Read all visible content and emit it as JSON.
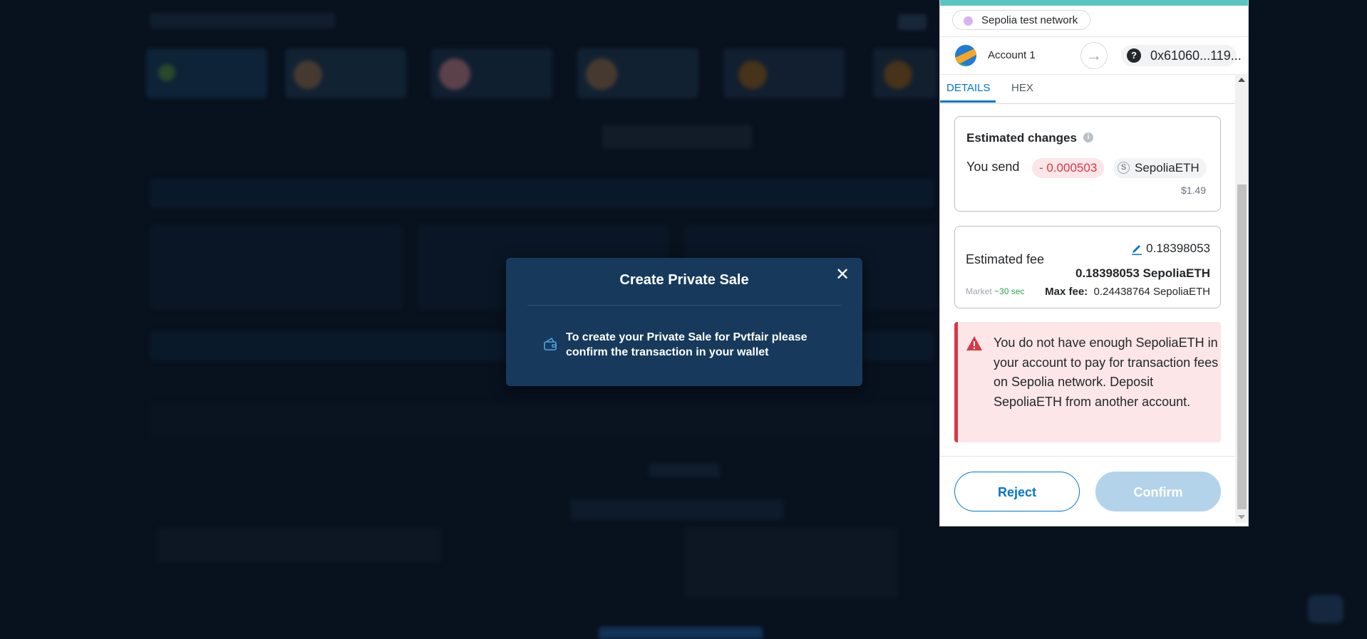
{
  "modal": {
    "title": "Create Private Sale",
    "close_glyph": "✕",
    "message": "To create your Private Sale for Pvtfair please confirm the transaction in your wallet",
    "icon": "wallet-icon"
  },
  "metamask": {
    "network": "Sepolia test network",
    "account_name": "Account 1",
    "address": "0x61060...119...",
    "arrow_glyph": "→",
    "tabs": [
      {
        "label": "DETAILS",
        "active": true
      },
      {
        "label": "HEX",
        "active": false
      }
    ],
    "estimated_changes": {
      "title": "Estimated changes",
      "send_label": "You send",
      "amount": "- 0.000503",
      "token": "SepoliaETH",
      "token_letter": "S",
      "fiat": "$1.49"
    },
    "fee": {
      "label": "Estimated fee",
      "amount": "0.18398053",
      "amount_bold": "0.18398053 SepoliaETH",
      "market_label": "Market",
      "market_time": "~30 sec",
      "max_fee_label": "Max fee:",
      "max_fee_value": "0.24438764 SepoliaETH"
    },
    "error": "You do not have enough SepoliaETH in your account to pay for transaction fees on Sepolia network. Deposit SepoliaETH from another account.",
    "buttons": {
      "reject": "Reject",
      "confirm": "Confirm"
    }
  },
  "colors": {
    "backdrop": "#0b1624",
    "modal_bg": "#173a5c",
    "metamask_blue": "#0376c9",
    "error_red": "#d73847",
    "teal_bar": "#5bc6c1"
  }
}
